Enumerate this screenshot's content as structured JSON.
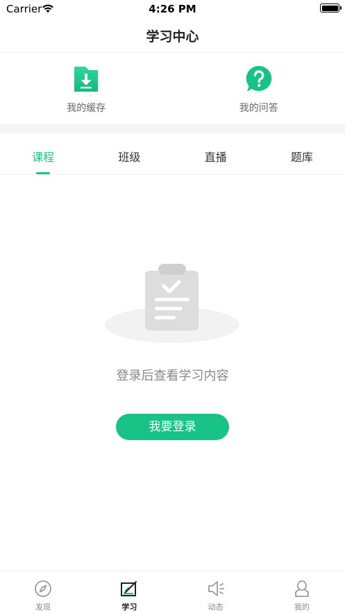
{
  "status_bar": {
    "carrier": "Carrier",
    "time": "4:26 PM"
  },
  "nav": {
    "title": "学习中心"
  },
  "quick_links": [
    {
      "label": "我的缓存",
      "icon": "download-folder-icon"
    },
    {
      "label": "我的问答",
      "icon": "question-bubble-icon"
    }
  ],
  "tabs": [
    {
      "label": "课程",
      "active": true
    },
    {
      "label": "班级",
      "active": false
    },
    {
      "label": "直播",
      "active": false
    },
    {
      "label": "题库",
      "active": false
    }
  ],
  "empty_state": {
    "icon": "clipboard-check-icon",
    "message": "登录后查看学习内容",
    "button_label": "我要登录"
  },
  "bottom_tabs": [
    {
      "label": "发现",
      "icon": "compass-icon",
      "active": false
    },
    {
      "label": "学习",
      "icon": "study-edit-icon",
      "active": true
    },
    {
      "label": "动态",
      "icon": "speaker-icon",
      "active": false
    },
    {
      "label": "我的",
      "icon": "person-icon",
      "active": false
    }
  ],
  "colors": {
    "accent": "#17c387",
    "muted_text": "#888888",
    "band": "#f5f5f5"
  }
}
